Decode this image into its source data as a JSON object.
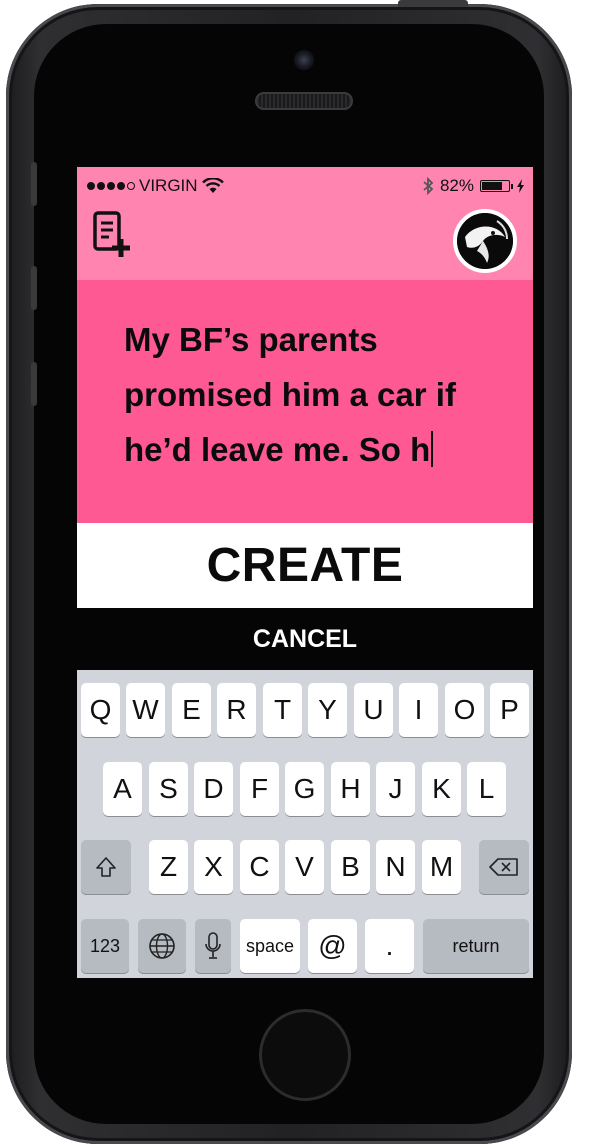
{
  "status_bar": {
    "carrier": "VIRGIN",
    "battery_percent": "82%",
    "battery_level": 0.82
  },
  "header": {
    "compose_icon": "new-post-icon",
    "avatar_icon": "koi-fish-avatar"
  },
  "composer": {
    "text": "My BF’s parents promised him a car if he’d leave me. So h"
  },
  "actions": {
    "create_label": "CREATE",
    "cancel_label": "CANCEL"
  },
  "keyboard": {
    "row1": [
      "Q",
      "W",
      "E",
      "R",
      "T",
      "Y",
      "U",
      "I",
      "O",
      "P"
    ],
    "row2": [
      "A",
      "S",
      "D",
      "F",
      "G",
      "H",
      "J",
      "K",
      "L"
    ],
    "row3": [
      "Z",
      "X",
      "C",
      "V",
      "B",
      "N",
      "M"
    ],
    "numbers_label": "123",
    "space_label": "space",
    "at_label": "@",
    "period_label": ".",
    "return_label": "return"
  },
  "colors": {
    "header_pink": "#ff85b0",
    "composer_pink": "#ff5993",
    "create_bg": "#ffffff",
    "cancel_bg": "#050505"
  }
}
